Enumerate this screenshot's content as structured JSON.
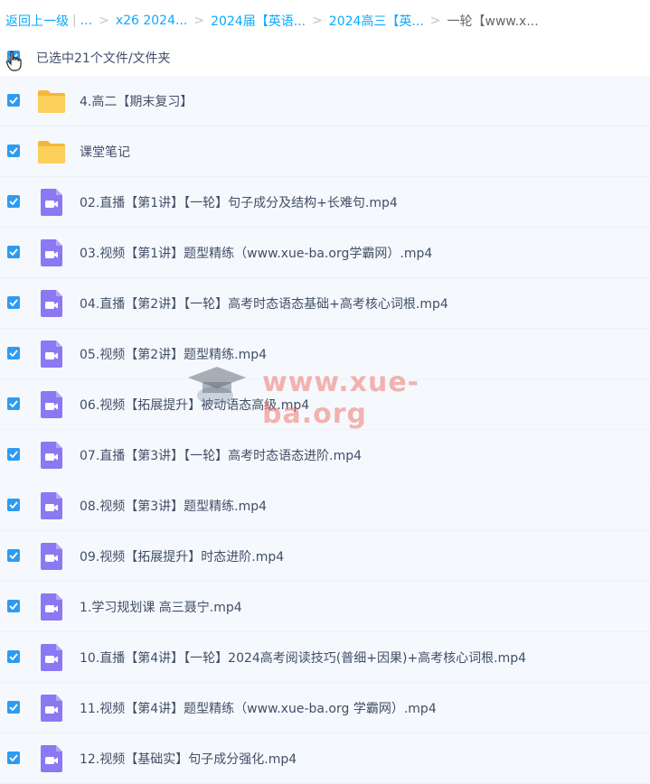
{
  "breadcrumb": {
    "back": "返回上一级",
    "first_sep": "|",
    "ellipsis": "...",
    "items": [
      "x26 2024...",
      "2024届【英语...",
      "2024高三【英...",
      "一轮【www.x..."
    ]
  },
  "selection": {
    "text": "已选中21个文件/文件夹"
  },
  "colors": {
    "accent": "#09aaff",
    "checkbox": "#2e9bf0",
    "folder": "#f9c33a",
    "video": "#8f7bf0",
    "row_bg": "#f5f9fe"
  },
  "files": [
    {
      "name": "4.高二【期末复习】",
      "type": "folder-icon"
    },
    {
      "name": "课堂笔记",
      "type": "folder-icon"
    },
    {
      "name": "02.直播【第1讲】【一轮】句子成分及结构+长难句.mp4",
      "type": "video-file-icon"
    },
    {
      "name": "03.视频【第1讲】题型精练（www.xue-ba.org学霸网）.mp4",
      "type": "video-file-icon"
    },
    {
      "name": "04.直播【第2讲】【一轮】高考时态语态基础+高考核心词根.mp4",
      "type": "video-file-icon"
    },
    {
      "name": "05.视频【第2讲】题型精练.mp4",
      "type": "video-file-icon"
    },
    {
      "name": "06.视频【拓展提升】被动语态高级.mp4",
      "type": "video-file-icon"
    },
    {
      "name": "07.直播【第3讲】【一轮】高考时态语态进阶.mp4",
      "type": "video-file-icon"
    },
    {
      "name": "08.视频【第3讲】题型精练.mp4",
      "type": "video-file-icon"
    },
    {
      "name": "09.视频【拓展提升】时态进阶.mp4",
      "type": "video-file-icon"
    },
    {
      "name": "1.学习规划课 高三聂宁.mp4",
      "type": "video-file-icon"
    },
    {
      "name": "10.直播【第4讲】【一轮】2024高考阅读技巧(普细+因果)+高考核心词根.mp4",
      "type": "video-file-icon"
    },
    {
      "name": "11.视频【第4讲】题型精练（www.xue-ba.org 学霸网）.mp4",
      "type": "video-file-icon"
    },
    {
      "name": "12.视频【基础实】句子成分强化.mp4",
      "type": "video-file-icon"
    }
  ],
  "watermark": {
    "text": "www.xue-ba.org"
  }
}
